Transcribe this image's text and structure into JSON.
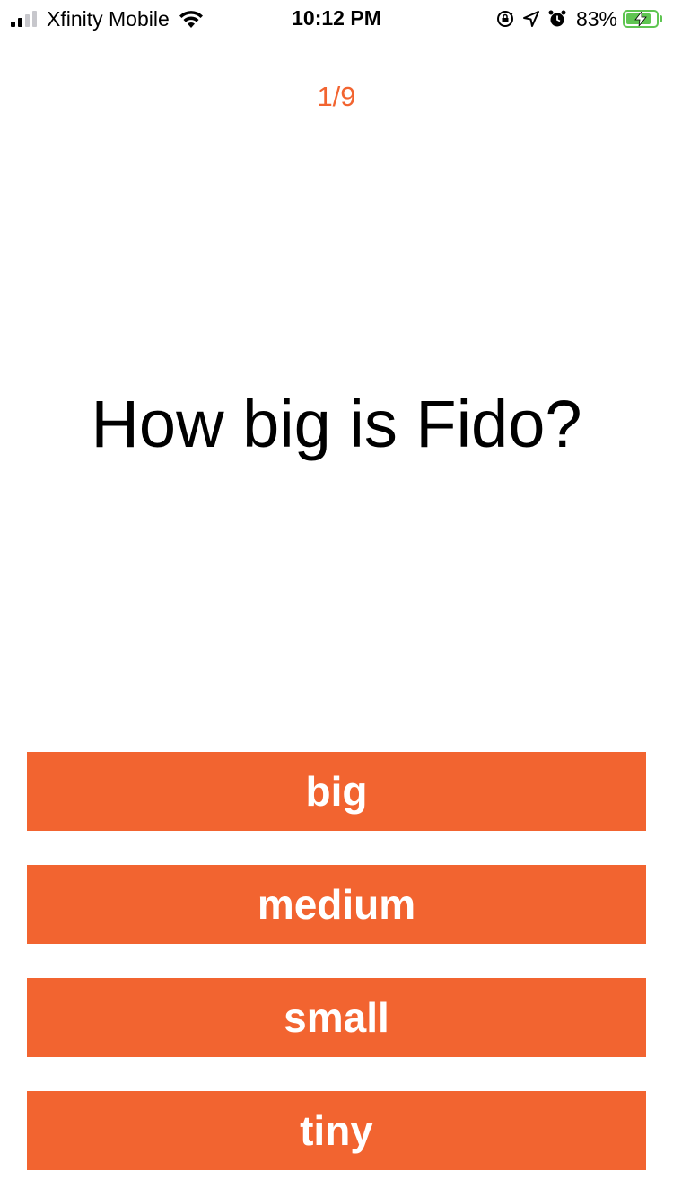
{
  "status_bar": {
    "carrier": "Xfinity Mobile",
    "time": "10:12 PM",
    "battery_percent": "83%",
    "battery_level": 0.83,
    "signal_bars_filled": 2,
    "signal_bars_total": 4,
    "icons": [
      "cellular-signal-icon",
      "wifi-icon",
      "orientation-lock-icon",
      "location-arrow-icon",
      "alarm-icon",
      "battery-charging-icon"
    ],
    "battery_color": "#5fc552"
  },
  "quiz": {
    "progress": "1/9",
    "question": "How big is Fido?",
    "answers": [
      {
        "label": "big"
      },
      {
        "label": "medium"
      },
      {
        "label": "small"
      },
      {
        "label": "tiny"
      }
    ]
  },
  "colors": {
    "accent": "#f26430",
    "background": "#ffffff",
    "text": "#000000"
  }
}
